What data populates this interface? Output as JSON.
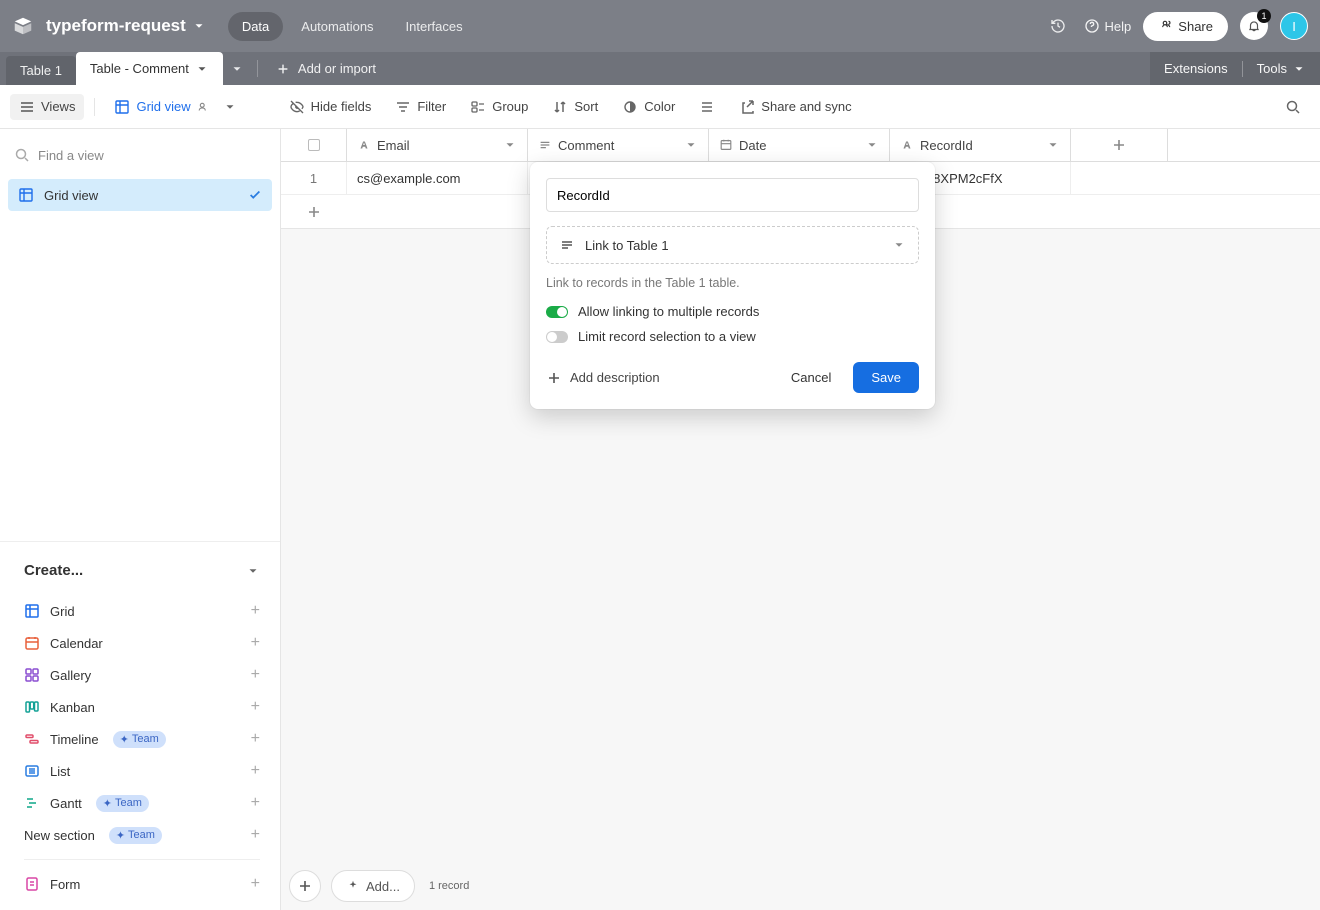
{
  "header": {
    "base_name": "typeform-request",
    "nav": {
      "data": "Data",
      "automations": "Automations",
      "interfaces": "Interfaces"
    },
    "help": "Help",
    "share": "Share",
    "notifications": "1",
    "avatar_initial": "I"
  },
  "tables": {
    "tab1": "Table 1",
    "tab2": "Table - Comment",
    "add_import": "Add or import",
    "extensions": "Extensions",
    "tools": "Tools"
  },
  "toolbar": {
    "views": "Views",
    "grid_view": "Grid view",
    "hide_fields": "Hide fields",
    "filter": "Filter",
    "group": "Group",
    "sort": "Sort",
    "color": "Color",
    "share_sync": "Share and sync"
  },
  "sidebar": {
    "find_placeholder": "Find a view",
    "active_view": "Grid view",
    "create": "Create...",
    "items": {
      "grid": "Grid",
      "calendar": "Calendar",
      "gallery": "Gallery",
      "kanban": "Kanban",
      "timeline": "Timeline",
      "list": "List",
      "gantt": "Gantt",
      "new_section": "New section",
      "form": "Form"
    },
    "team_badge": "Team"
  },
  "grid": {
    "columns": {
      "email": "Email",
      "comment": "Comment",
      "date": "Date",
      "recordid": "RecordId"
    },
    "rows": [
      {
        "n": "1",
        "email": "cs@example.com",
        "comment": "",
        "date": "",
        "recordid": "Ey8XPM2cFfX"
      }
    ],
    "footer_add": "Add...",
    "record_count": "1 record"
  },
  "popup": {
    "field_name": "RecordId",
    "type_label": "Link to Table 1",
    "description": "Link to records in the Table 1 table.",
    "allow_multi": "Allow linking to multiple records",
    "limit_view": "Limit record selection to a view",
    "add_description": "Add description",
    "cancel": "Cancel",
    "save": "Save"
  }
}
